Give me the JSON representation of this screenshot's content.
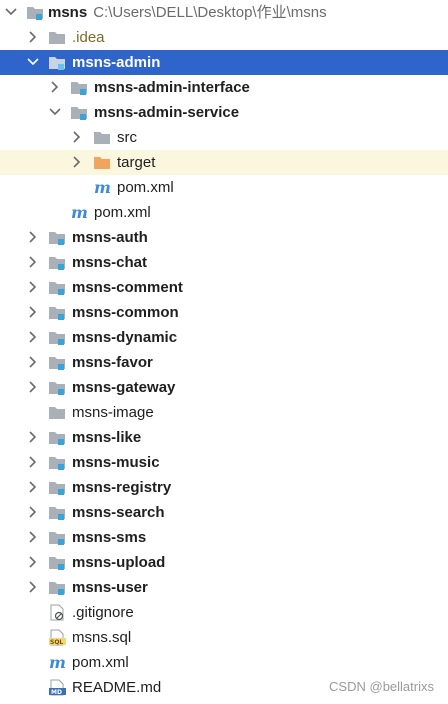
{
  "tree": {
    "root": {
      "label": "msns",
      "path": "C:\\Users\\DELL\\Desktop\\作业\\msns"
    },
    "idea": {
      "label": ".idea"
    },
    "admin": {
      "label": "msns-admin"
    },
    "admin_interface": {
      "label": "msns-admin-interface"
    },
    "admin_service": {
      "label": "msns-admin-service"
    },
    "src": {
      "label": "src"
    },
    "target": {
      "label": "target"
    },
    "service_pom": {
      "label": "pom.xml"
    },
    "admin_pom": {
      "label": "pom.xml"
    },
    "modules": [
      {
        "label": "msns-auth"
      },
      {
        "label": "msns-chat"
      },
      {
        "label": "msns-comment"
      },
      {
        "label": "msns-common"
      },
      {
        "label": "msns-dynamic"
      },
      {
        "label": "msns-favor"
      },
      {
        "label": "msns-gateway"
      },
      {
        "label": "msns-image"
      },
      {
        "label": "msns-like"
      },
      {
        "label": "msns-music"
      },
      {
        "label": "msns-registry"
      },
      {
        "label": "msns-search"
      },
      {
        "label": "msns-sms"
      },
      {
        "label": "msns-upload"
      },
      {
        "label": "msns-user"
      }
    ],
    "files": [
      {
        "label": ".gitignore"
      },
      {
        "label": "msns.sql"
      },
      {
        "label": "pom.xml"
      },
      {
        "label": "README.md"
      }
    ]
  },
  "watermark": "CSDN @bellatrixs",
  "colors": {
    "selection": "#2f65ca",
    "highlight_row": "#fbf6de",
    "module_badge": "#3aa3d9",
    "folder": "#a9b0b8",
    "excluded_folder": "#f2a35e",
    "maven": "#3d8bd9"
  }
}
